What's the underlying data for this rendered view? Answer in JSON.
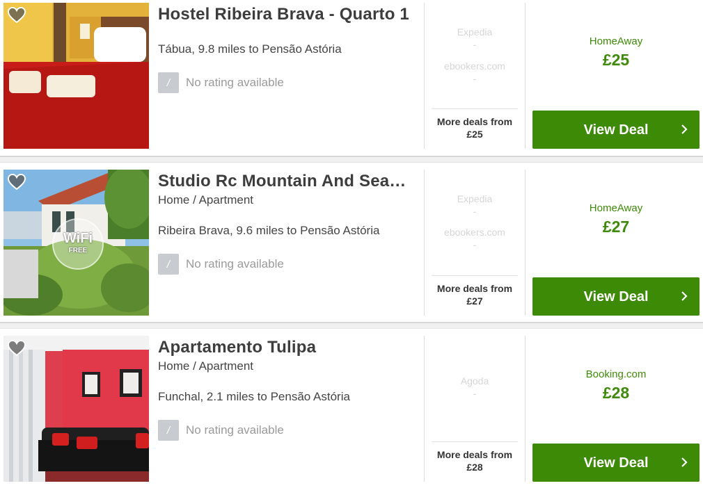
{
  "listings": [
    {
      "title": "Hostel Ribeira Brava - Quarto 1",
      "type": "",
      "location": "Tábua, 9.8 miles to Pensão Astória",
      "rating_badge": "/",
      "rating_text": "No rating available",
      "other_providers": [
        "Expedia",
        "ebookers.com"
      ],
      "dashes": [
        "-",
        "-"
      ],
      "more_deals_label": "More deals from",
      "more_deals_price": "£25",
      "best_provider": "HomeAway",
      "best_price": "£25",
      "button_label": "View Deal"
    },
    {
      "title": "Studio Rc Mountain And Sea…",
      "type": "Home / Apartment",
      "location": "Ribeira Brava, 9.6 miles to Pensão Astória",
      "rating_badge": "/",
      "rating_text": "No rating available",
      "photo_badge_text": "WiFi",
      "photo_badge_sub": "FREE",
      "other_providers": [
        "Expedia",
        "ebookers.com"
      ],
      "dashes": [
        "-",
        "-"
      ],
      "more_deals_label": "More deals from",
      "more_deals_price": "£27",
      "best_provider": "HomeAway",
      "best_price": "£27",
      "button_label": "View Deal"
    },
    {
      "title": "Apartamento Tulipa",
      "type": "Home / Apartment",
      "location": "Funchal, 2.1 miles to Pensão Astória",
      "rating_badge": "/",
      "rating_text": "No rating available",
      "other_providers": [
        "Agoda"
      ],
      "dashes": [
        "-"
      ],
      "more_deals_label": "More deals from",
      "more_deals_price": "£28",
      "best_provider": "Booking.com",
      "best_price": "£28",
      "button_label": "View Deal"
    }
  ],
  "colors": {
    "accent": "#3d8a06",
    "price": "#3f8a0a",
    "muted": "#9a9a9a"
  }
}
